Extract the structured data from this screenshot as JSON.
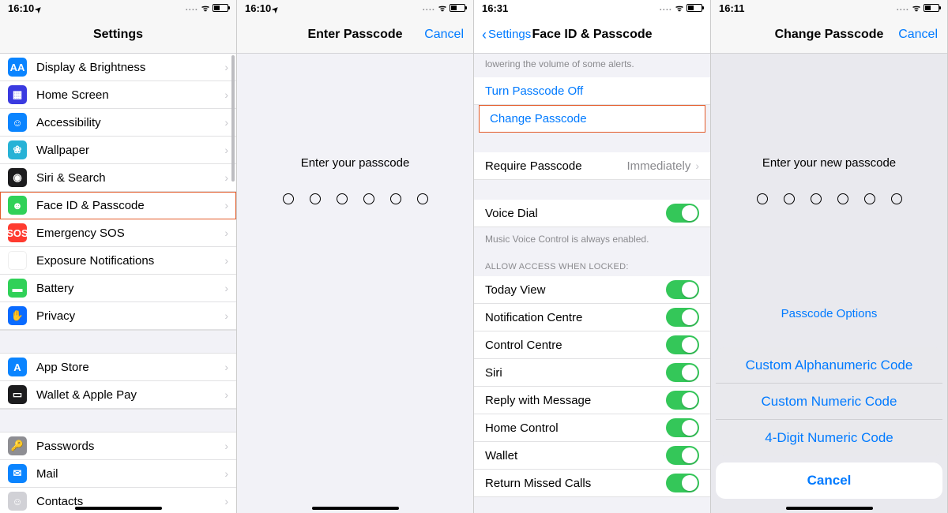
{
  "status": {
    "time_a": "16:10",
    "time_b": "16:31",
    "time_c": "16:11",
    "signal": "....",
    "wifi": "ᯤ"
  },
  "screen1": {
    "title": "Settings",
    "rows": {
      "display": "Display & Brightness",
      "home": "Home Screen",
      "access": "Accessibility",
      "wall": "Wallpaper",
      "siri": "Siri & Search",
      "faceid": "Face ID & Passcode",
      "sos": "Emergency SOS",
      "expo": "Exposure Notifications",
      "batt": "Battery",
      "priv": "Privacy",
      "appstore": "App Store",
      "wallet": "Wallet & Apple Pay",
      "pw": "Passwords",
      "mail": "Mail",
      "contacts": "Contacts"
    },
    "icons": {
      "sos_text": "SOS",
      "display_text": "AA"
    }
  },
  "screen2": {
    "title": "Enter Passcode",
    "cancel": "Cancel",
    "prompt": "Enter your passcode"
  },
  "screen3": {
    "back": "Settings",
    "title": "Face ID & Passcode",
    "top_desc": "lowering the volume of some alerts.",
    "turn_off": "Turn Passcode Off",
    "change": "Change Passcode",
    "require_label": "Require Passcode",
    "require_value": "Immediately",
    "voice_dial": "Voice Dial",
    "voice_footnote": "Music Voice Control is always enabled.",
    "section_header": "Allow Access When Locked:",
    "toggles": {
      "today": "Today View",
      "notif": "Notification Centre",
      "control": "Control Centre",
      "siri": "Siri",
      "reply": "Reply with Message",
      "homec": "Home Control",
      "wallet": "Wallet",
      "missed": "Return Missed Calls"
    }
  },
  "screen4": {
    "title": "Change Passcode",
    "cancel": "Cancel",
    "prompt": "Enter your new passcode",
    "options_link": "Passcode Options",
    "sheet": {
      "alpha": "Custom Alphanumeric Code",
      "numeric": "Custom Numeric Code",
      "four": "4-Digit Numeric Code",
      "cancel": "Cancel"
    }
  }
}
